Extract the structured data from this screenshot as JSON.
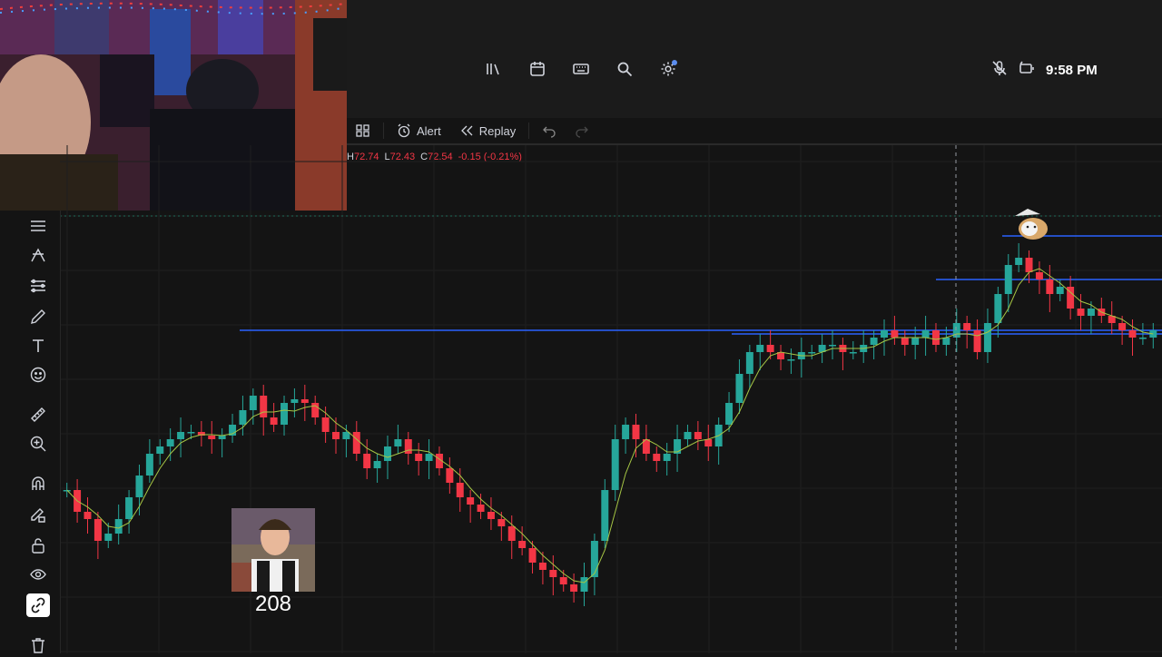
{
  "header": {
    "icons": [
      "library-icon",
      "calendar-icon",
      "keyboard-icon",
      "search-icon",
      "gear-icon"
    ],
    "status_icons": [
      "mic-muted-icon",
      "battery-icon"
    ],
    "time": "9:58 PM"
  },
  "toolbar": {
    "alert_label": "Alert",
    "replay_label": "Replay"
  },
  "legend": {
    "high_label": "H",
    "high_value": "72.74",
    "low_label": "L",
    "low_value": "72.43",
    "close_label": "C",
    "close_value": "72.54",
    "change": "-0.15 (-0.21%)"
  },
  "sidebar": {
    "tools": [
      "menu-icon",
      "trendline-icon",
      "fib-icon",
      "brush-icon",
      "text-icon",
      "emoji-icon",
      "ruler-icon",
      "zoom-icon",
      "magnet-icon",
      "lock-drawing-icon",
      "lock-icon",
      "eye-icon",
      "link-icon",
      "trash-icon"
    ],
    "active_tool": "link-icon"
  },
  "overlay": {
    "meme_count": "208"
  },
  "colors": {
    "up": "#26a69a",
    "down": "#f23645",
    "level_line": "#2962ff",
    "ma_line": "#a5c544",
    "accent": "#5b8def"
  },
  "chart_data": {
    "type": "candlestick",
    "series": [
      {
        "name": "price",
        "values": [
          30,
          24,
          22,
          16,
          18,
          22,
          28,
          34,
          40,
          42,
          44,
          46,
          46,
          45,
          44,
          45,
          48,
          52,
          56,
          50,
          48,
          54,
          55,
          54,
          50,
          46,
          44,
          46,
          40,
          36,
          38,
          42,
          44,
          40,
          38,
          40,
          36,
          32,
          28,
          26,
          24,
          22,
          20,
          16,
          14,
          10,
          8,
          6,
          4,
          2,
          6,
          16,
          30,
          44,
          48,
          44,
          40,
          38,
          40,
          44,
          46,
          44,
          42,
          48,
          54,
          62,
          68,
          70,
          68,
          66,
          66,
          68,
          68,
          70,
          70,
          68,
          68,
          70,
          72,
          74,
          72,
          70,
          72,
          74,
          70,
          72,
          76,
          74,
          68,
          76,
          84,
          92,
          94,
          90,
          88,
          84,
          86,
          80,
          78,
          80,
          78,
          76,
          74,
          72,
          72,
          74
        ]
      }
    ],
    "levels": [
      {
        "name": "level-1",
        "value": 100
      },
      {
        "name": "level-2",
        "value": 88
      },
      {
        "name": "level-3",
        "value": 74
      },
      {
        "name": "level-4",
        "value": 73
      }
    ],
    "grid": true,
    "crosshair": true
  }
}
